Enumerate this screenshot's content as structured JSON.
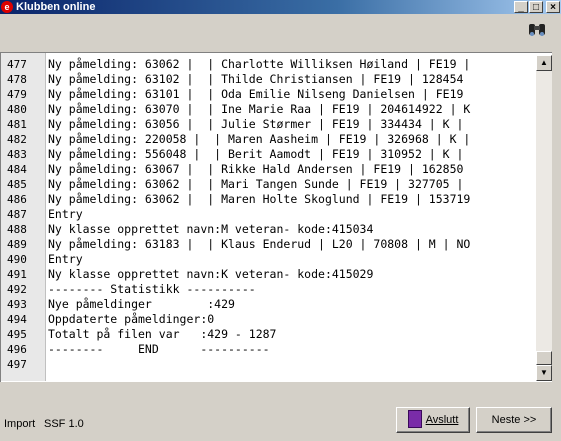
{
  "window": {
    "title": "Klubben online"
  },
  "title_buttons": [
    "_",
    "□",
    "×"
  ],
  "toolbar": {
    "search_icon": "binoculars-icon"
  },
  "lines": [
    {
      "num": "477",
      "text": "Ny påmelding: 63062 |  | Charlotte Williksen Høiland | FE19 |"
    },
    {
      "num": "478",
      "text": "Ny påmelding: 63102 |  | Thilde Christiansen | FE19 | 128454"
    },
    {
      "num": "479",
      "text": "Ny påmelding: 63101 |  | Oda Emilie Nilseng Danielsen | FE19"
    },
    {
      "num": "480",
      "text": "Ny påmelding: 63070 |  | Ine Marie Raa | FE19 | 204614922 | K"
    },
    {
      "num": "481",
      "text": "Ny påmelding: 63056 |  | Julie Størmer | FE19 | 334434 | K |"
    },
    {
      "num": "482",
      "text": "Ny påmelding: 220058 |  | Maren Aasheim | FE19 | 326968 | K |"
    },
    {
      "num": "483",
      "text": "Ny påmelding: 556048 |  | Berit Aamodt | FE19 | 310952 | K |"
    },
    {
      "num": "484",
      "text": "Ny påmelding: 63067 |  | Rikke Hald Andersen | FE19 | 162850"
    },
    {
      "num": "485",
      "text": "Ny påmelding: 63062 |  | Mari Tangen Sunde | FE19 | 327705 |"
    },
    {
      "num": "486",
      "text": "Ny påmelding: 63062 |  | Maren Holte Skoglund | FE19 | 153719"
    },
    {
      "num": "487",
      "text": "Entry"
    },
    {
      "num": "488",
      "text": "Ny klasse opprettet navn:M veteran- kode:415034"
    },
    {
      "num": "489",
      "text": "Ny påmelding: 63183 |  | Klaus Enderud | L20 | 70808 | M | NO"
    },
    {
      "num": "490",
      "text": "Entry"
    },
    {
      "num": "491",
      "text": "Ny klasse opprettet navn:K veteran- kode:415029"
    },
    {
      "num": "492",
      "text": "-------- Statistikk ----------"
    },
    {
      "num": "493",
      "text": "Nye påmeldinger        :429"
    },
    {
      "num": "494",
      "text": "Oppdaterte påmeldinger:0"
    },
    {
      "num": "495",
      "text": "Totalt på filen var   :429 - 1287"
    },
    {
      "num": "496",
      "text": "--------     END      ----------"
    },
    {
      "num": "497",
      "text": ""
    }
  ],
  "scrollbar": {
    "up": "▲",
    "down": "▼"
  },
  "status": {
    "label": "Import",
    "format": "SSF 1.0"
  },
  "buttons": {
    "exit_label": "Avslutt",
    "next_label": "Neste >>"
  }
}
